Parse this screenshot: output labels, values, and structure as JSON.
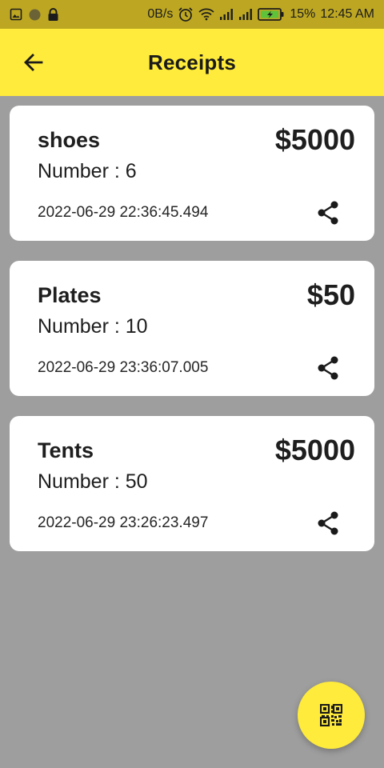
{
  "status_bar": {
    "speed": "0B/s",
    "battery_percent": "15%",
    "time": "12:45 AM",
    "icons": [
      "image-icon",
      "circle-icon",
      "lock-icon",
      "alarm-icon",
      "wifi-icon",
      "signal-icon",
      "signal-icon",
      "battery-charging-icon"
    ]
  },
  "app_bar": {
    "title": "Receipts",
    "back_icon": "arrow-left-icon",
    "background": "#ffeb3b"
  },
  "receipts": [
    {
      "name": "shoes",
      "price": "$5000",
      "number": "Number : 6",
      "date": "2022-06-29 22:36:45.494"
    },
    {
      "name": "Plates",
      "price": "$50",
      "number": "Number : 10",
      "date": "2022-06-29 23:36:07.005"
    },
    {
      "name": "Tents",
      "price": "$5000",
      "number": "Number : 50",
      "date": "2022-06-29 23:26:23.497"
    }
  ],
  "fab": {
    "icon": "qr-code-icon",
    "color": "#ffeb3b"
  },
  "colors": {
    "background": "#9e9e9e",
    "card": "#ffffff",
    "status_bar": "#bda722"
  }
}
